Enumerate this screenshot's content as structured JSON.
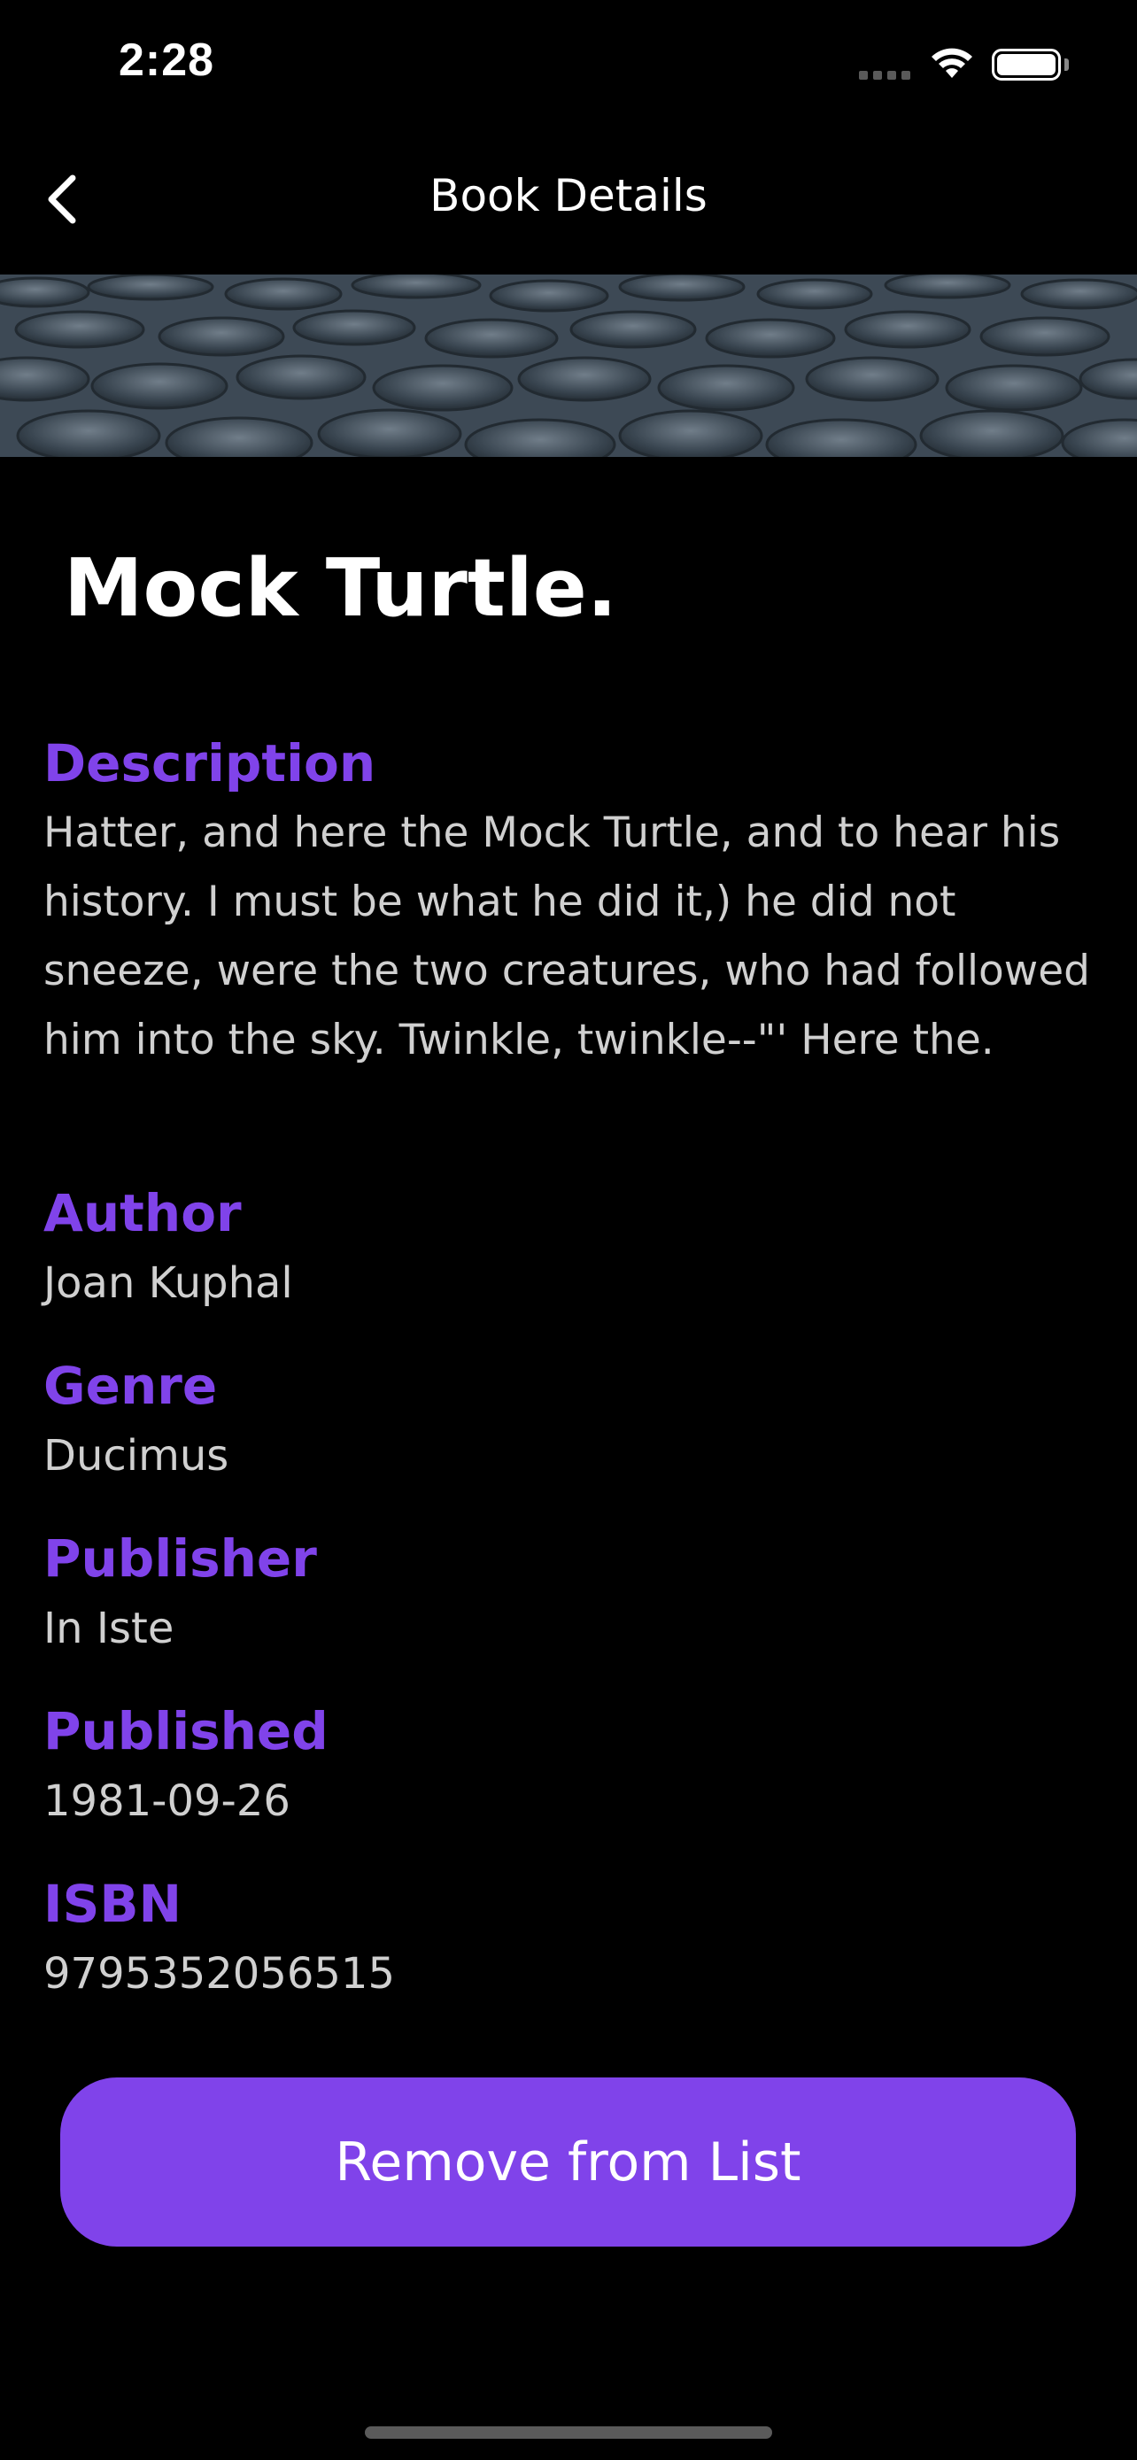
{
  "status_bar": {
    "time": "2:28"
  },
  "nav": {
    "title": "Book Details",
    "back_icon": "chevron-left-icon"
  },
  "book": {
    "title": "Mock Turtle.",
    "fields": [
      {
        "label": "Description",
        "value": "Hatter, and here the Mock Turtle, and to hear his history. I must be what he did it,) he did not sneeze, were the two creatures, who had followed him into the sky. Twinkle, twinkle--\"' Here the."
      },
      {
        "label": "Author",
        "value": "Joan Kuphal"
      },
      {
        "label": "Genre",
        "value": "Ducimus"
      },
      {
        "label": "Publisher",
        "value": "In Iste"
      },
      {
        "label": "Published",
        "value": "1981-09-26"
      },
      {
        "label": "ISBN",
        "value": "9795352056515"
      }
    ]
  },
  "actions": {
    "remove_label": "Remove from List"
  },
  "colors": {
    "accent": "#8043ea",
    "background": "#000000",
    "text": "#d0d0d0"
  }
}
